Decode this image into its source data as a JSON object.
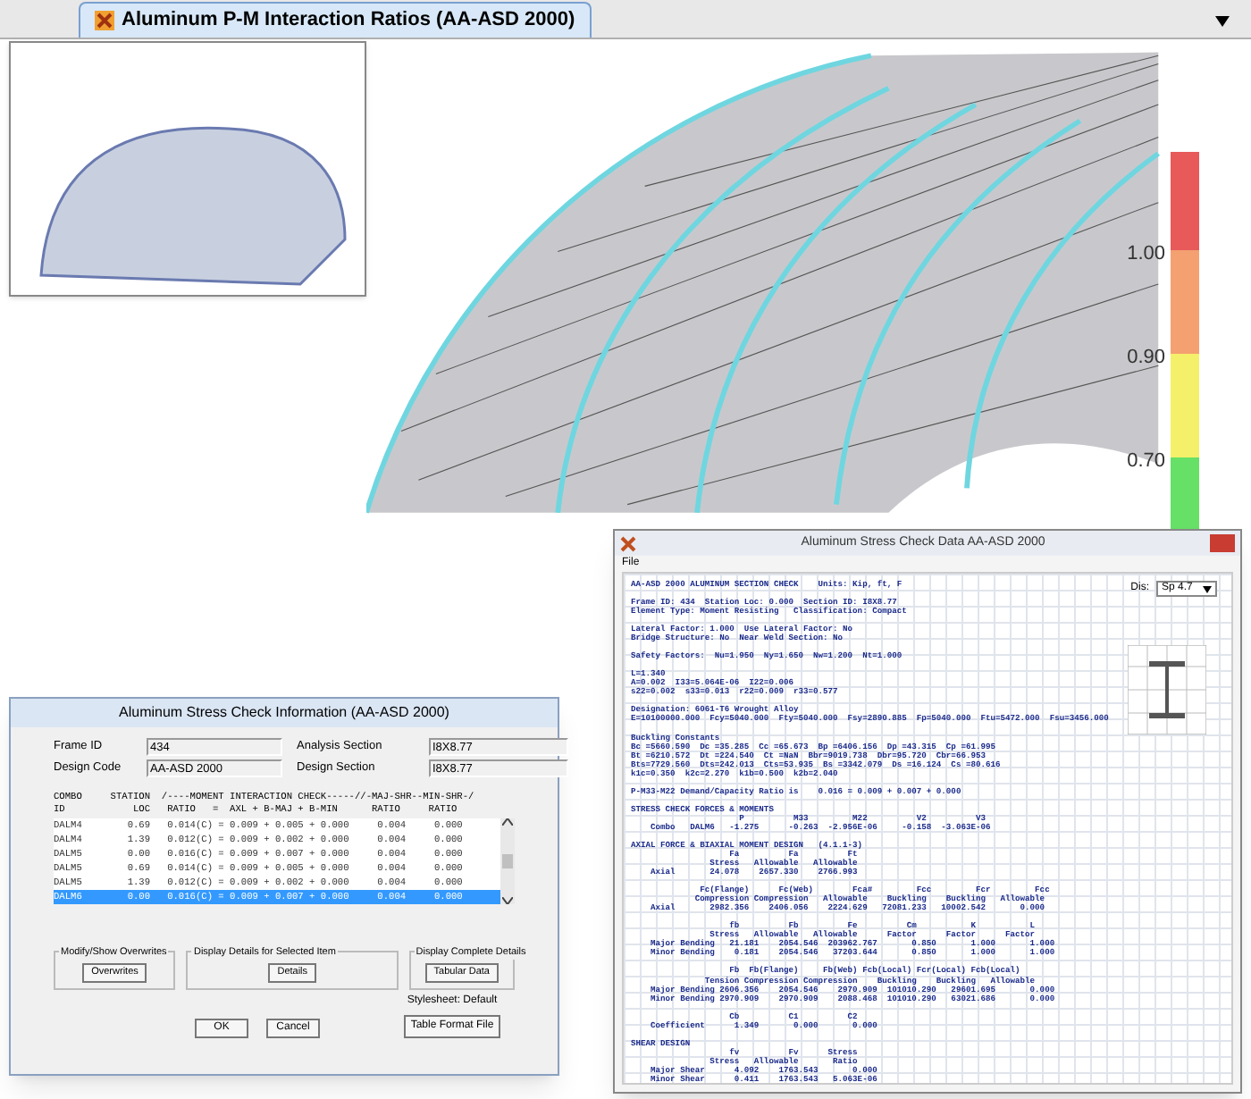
{
  "tab": {
    "title": "Aluminum P-M Interaction Ratios  (AA-ASD 2000)",
    "selected": true
  },
  "legend": {
    "segments": [
      {
        "color": "#e85a5a"
      },
      {
        "color": "#f4a070"
      },
      {
        "color": "#f4f06a"
      },
      {
        "color": "#66e066"
      }
    ],
    "labels": [
      "1.00",
      "0.90",
      "0.70"
    ]
  },
  "report": {
    "title": "Aluminum Stress Check Data  AA-ASD 2000",
    "menu": [
      "File"
    ],
    "units_label": "Dis:",
    "units_value": "Sp 4.7",
    "blocks": [
      [
        "AA-ASD 2000 ALUMINUM SECTION CHECK    Units: Kip, ft, F"
      ],
      [
        "Frame ID: 434  Station Loc: 0.000  Section ID: I8X8.77",
        "Element Type: Moment Resisting   Classification: Compact"
      ],
      [
        "Lateral Factor: 1.000  Use Lateral Factor: No",
        "Bridge Structure: No  Near Weld Section: No"
      ],
      [
        "Safety Factors:  Nu=1.950  Ny=1.650  Nw=1.200  Nt=1.000"
      ],
      [
        "L=1.340",
        "A=0.002  I33=5.064E-06  I22=0.006",
        "s22=0.002  s33=0.013  r22=0.009  r33=0.577"
      ],
      [
        "Designation: 6061-T6 Wrought Alloy",
        "E=10100000.000  Fcy=5040.000  Fty=5040.000  Fsy=2890.885  Fp=5040.000  Ftu=5472.000  Fsu=3456.000"
      ],
      [
        "Buckling Constants",
        "Bc =5660.590  Dc =35.285  Cc =65.673  Bp =6406.156  Dp =43.315  Cp =61.995",
        "Bt =6210.572  Dt =224.540  Ct =NaN  Bbr=9019.738  Dbr=95.720  Cbr=66.953",
        "Bts=7729.560  Dts=242.013  Cts=53.935  Bs =3342.079  Ds =16.124  Cs =80.616",
        "k1c=0.350  k2c=2.270  k1b=0.500  k2b=2.040"
      ],
      [
        "P-M33-M22 Demand/Capacity Ratio is    0.016 = 0.009 + 0.007 + 0.000"
      ],
      [
        "STRESS CHECK FORCES & MOMENTS",
        "                      P          M33         M22          V2          V3",
        "    Combo   DALM6   -1.275      -0.263  -2.956E-06     -0.158  -3.063E-06"
      ],
      [
        "AXIAL FORCE & BIAXIAL MOMENT DESIGN   (4.1.1-3)",
        "                    Fa          Fa          Ft",
        "                Stress   Allowable   Allowable",
        "    Axial       24.078    2657.330    2766.993"
      ],
      [
        "              Fc(Flange)      Fc(Web)        Fca#         Fcc         Fcr         Fcc",
        "             Compression Compression   Allowable    Buckling    Buckling   Allowable",
        "    Axial       2982.356    2406.056    2224.629   72081.233   10002.542       0.000"
      ],
      [
        "                    fb          Fb          Fe          Cm           K           L",
        "                Stress   Allowable   Allowable      Factor      Factor      Factor",
        "    Major Bending   21.181    2054.546  203962.767       0.850       1.000       1.000",
        "    Minor Bending    0.181    2054.546   37203.644       0.850       1.000       1.000"
      ],
      [
        "                    Fb  Fb(Flange)     Fb(Web) Fcb(Local) Fcr(Local) Fcb(Local)",
        "               Tension Compression Compression    Buckling    Buckling   Allowable",
        "    Major Bending 2606.356    2054.546    2970.909  101010.290   29601.695       0.000",
        "    Minor Bending 2970.909    2970.909    2088.468  101010.290   63021.686       0.000"
      ],
      [
        "                    Cb          C1          C2",
        "    Coefficient      1.349       0.000       0.000"
      ],
      [
        "SHEAR DESIGN",
        "                    fv          Fv      Stress",
        "                Stress   Allowable       Ratio",
        "    Major Shear      4.092    1763.543       0.000",
        "    Minor Shear      0.411    1763.543   5.063E-06"
      ]
    ]
  },
  "dialog": {
    "title": "Aluminum Stress Check Information (AA-ASD 2000)",
    "fields": [
      {
        "label": "Frame ID",
        "value": "434"
      },
      {
        "label": "Analysis Section",
        "value": "I8X8.77"
      },
      {
        "label": "Design Code",
        "value": "AA-ASD 2000"
      },
      {
        "label": "Design Section",
        "value": "I8X8.77"
      }
    ],
    "header": [
      "COMBO     STATION  /----MOMENT INTERACTION CHECK-----//-MAJ-SHR--MIN-SHR-/",
      "ID            LOC   RATIO   =  AXL + B-MAJ + B-MIN      RATIO     RATIO"
    ],
    "rows": [
      {
        "text": "DALM4        0.69   0.014(C) = 0.009 + 0.005 + 0.000     0.004     0.000",
        "selected": false
      },
      {
        "text": "DALM4        1.39   0.012(C) = 0.009 + 0.002 + 0.000     0.004     0.000",
        "selected": false
      },
      {
        "text": "DALM5        0.00   0.016(C) = 0.009 + 0.007 + 0.000     0.004     0.000",
        "selected": false
      },
      {
        "text": "DALM5        0.69   0.014(C) = 0.009 + 0.005 + 0.000     0.004     0.000",
        "selected": false
      },
      {
        "text": "DALM5        1.39   0.012(C) = 0.009 + 0.002 + 0.000     0.004     0.000",
        "selected": false
      },
      {
        "text": "DALM6        0.00   0.016(C) = 0.009 + 0.007 + 0.000     0.004     0.000",
        "selected": true
      }
    ],
    "groups": [
      {
        "title": "Modify/Show Overwrites",
        "button": "Overwrites"
      },
      {
        "title": "Display Details for Selected Item",
        "button": "Details"
      },
      {
        "title": "Display Complete Details",
        "button": "Tabular Data"
      }
    ],
    "stylesheet": "Stylesheet: Default",
    "buttons": [
      "OK",
      "Cancel"
    ],
    "format_button": "Table Format File"
  }
}
